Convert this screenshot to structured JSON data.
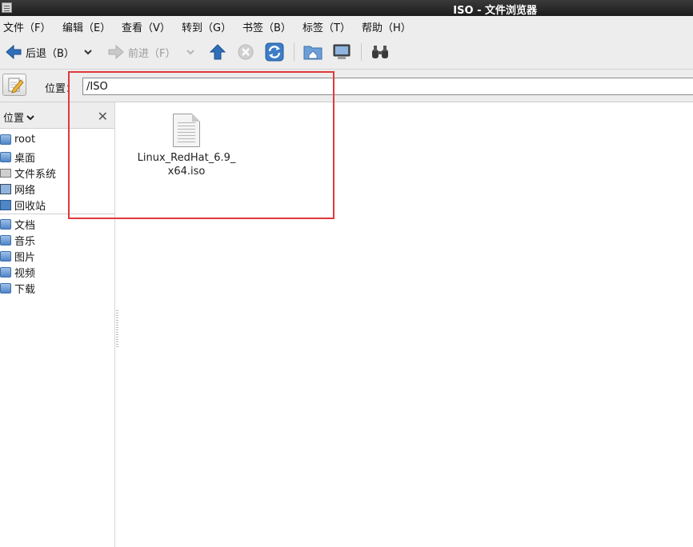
{
  "window": {
    "title": "ISO - 文件浏览器"
  },
  "menu": [
    "文件（F）",
    "编辑（E）",
    "查看（V）",
    "转到（G）",
    "书签（B）",
    "标签（T）",
    "帮助（H）"
  ],
  "toolbar": {
    "back_label": "后退（B）",
    "forward_label": "前进（F）"
  },
  "location": {
    "label": "位置：",
    "path": "/ISO"
  },
  "sidebar": {
    "header": "位置",
    "places": [
      {
        "label": "root",
        "icon": "home-folder-icon"
      },
      {
        "label": "桌面",
        "icon": "desktop-folder-icon"
      },
      {
        "label": "文件系统",
        "icon": "drive-icon"
      },
      {
        "label": "网络",
        "icon": "network-icon"
      },
      {
        "label": "回收站",
        "icon": "trash-icon"
      }
    ],
    "bookmarks": [
      {
        "label": "文档",
        "icon": "documents-folder-icon"
      },
      {
        "label": "音乐",
        "icon": "music-folder-icon"
      },
      {
        "label": "图片",
        "icon": "pictures-folder-icon"
      },
      {
        "label": "视频",
        "icon": "videos-folder-icon"
      },
      {
        "label": "下载",
        "icon": "downloads-folder-icon"
      }
    ]
  },
  "files": [
    {
      "name": "Linux_RedHat_6.9_x64.iso"
    }
  ],
  "colors": {
    "highlight": "#e0393b",
    "accent": "#3d6fae"
  }
}
